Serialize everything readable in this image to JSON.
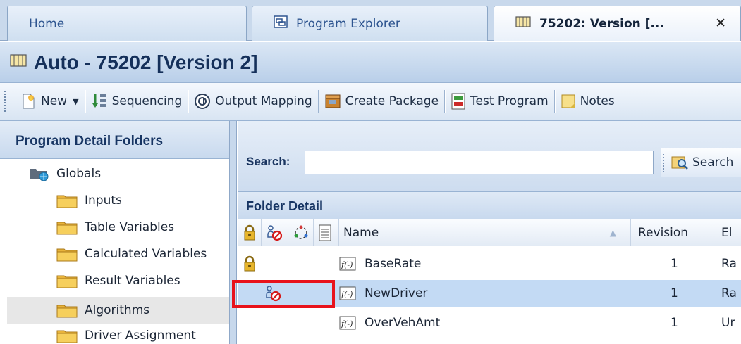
{
  "tabs": [
    {
      "label": "Home",
      "icon": null
    },
    {
      "label": "Program Explorer",
      "icon": "program-explorer-icon"
    },
    {
      "label": "75202: Version [...",
      "icon": "program-book-icon",
      "close": "✕"
    }
  ],
  "title": "Auto - 75202 [Version 2]",
  "toolbar": {
    "new": "New",
    "sequencing": "Sequencing",
    "output_mapping": "Output Mapping",
    "create_package": "Create Package",
    "test_program": "Test Program",
    "notes": "Notes"
  },
  "left_panel": {
    "header": "Program Detail Folders",
    "root": "Globals",
    "folders": [
      "Inputs",
      "Table Variables",
      "Calculated Variables",
      "Result Variables",
      "Algorithms",
      "Driver Assignment"
    ],
    "selected_index": 4
  },
  "search": {
    "label": "Search:",
    "value": "",
    "button": "Search"
  },
  "folder_detail": {
    "header": "Folder Detail",
    "columns": {
      "name": "Name",
      "revision": "Revision",
      "extra": "El"
    },
    "rows": [
      {
        "name": "BaseRate",
        "revision": "1",
        "extra": "Ra",
        "locked": true,
        "checked_out": false,
        "selected": false
      },
      {
        "name": "NewDriver",
        "revision": "1",
        "extra": "Ra",
        "locked": false,
        "checked_out": true,
        "selected": true
      },
      {
        "name": "OverVehAmt",
        "revision": "1",
        "extra": "Ur",
        "locked": false,
        "checked_out": false,
        "selected": false
      }
    ]
  },
  "colors": {
    "highlight_border": "#e8121b",
    "selected_row": "#c3daf4",
    "header_blue": "#173563"
  }
}
